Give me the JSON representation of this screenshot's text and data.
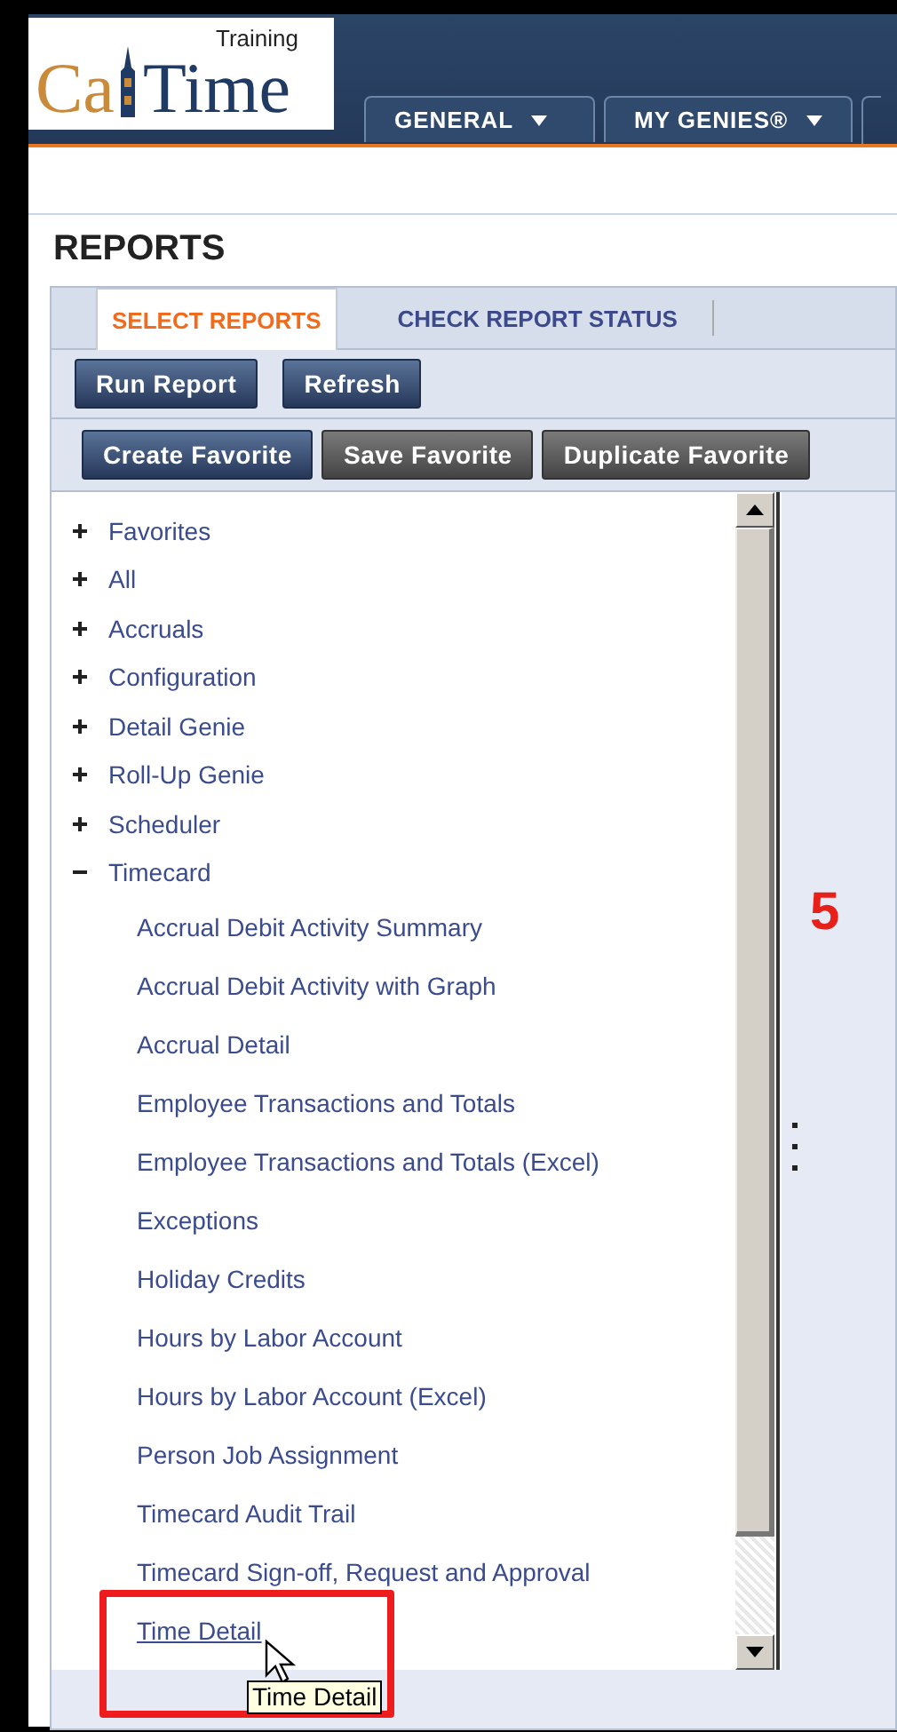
{
  "logo": {
    "tag": "Training",
    "part1": "Ca",
    "part2": "Time"
  },
  "nav_tabs": [
    {
      "label": "GENERAL"
    },
    {
      "label": "MY GENIES®"
    }
  ],
  "page_title": "REPORTS",
  "report_tabs": [
    {
      "label": "SELECT REPORTS",
      "selected": true
    },
    {
      "label": "CHECK REPORT STATUS",
      "selected": false
    }
  ],
  "toolbar": [
    "Run Report",
    "Refresh"
  ],
  "favorite_buttons": [
    {
      "label": "Create Favorite",
      "kind": "primary"
    },
    {
      "label": "Save Favorite",
      "kind": "secondary"
    },
    {
      "label": "Duplicate Favorite",
      "kind": "secondary"
    }
  ],
  "tree": [
    {
      "label": "Favorites",
      "expanded": false
    },
    {
      "label": "All",
      "expanded": false
    },
    {
      "label": "Accruals",
      "expanded": false
    },
    {
      "label": "Configuration",
      "expanded": false
    },
    {
      "label": "Detail Genie",
      "expanded": false
    },
    {
      "label": "Roll-Up Genie",
      "expanded": false
    },
    {
      "label": "Scheduler",
      "expanded": false
    },
    {
      "label": "Timecard",
      "expanded": true,
      "children": [
        {
          "label": "Accrual Debit Activity Summary",
          "hovered": false
        },
        {
          "label": "Accrual Debit Activity with Graph",
          "hovered": false
        },
        {
          "label": "Accrual Detail",
          "hovered": false
        },
        {
          "label": "Employee Transactions and Totals",
          "hovered": false
        },
        {
          "label": "Employee Transactions and Totals (Excel)",
          "hovered": false
        },
        {
          "label": "Exceptions",
          "hovered": false
        },
        {
          "label": "Holiday Credits",
          "hovered": false
        },
        {
          "label": "Hours by Labor Account",
          "hovered": false
        },
        {
          "label": "Hours by Labor Account (Excel)",
          "hovered": false
        },
        {
          "label": "Person Job Assignment",
          "hovered": false
        },
        {
          "label": "Timecard Audit Trail",
          "hovered": false
        },
        {
          "label": "Timecard Sign-off, Request and Approval",
          "hovered": false
        },
        {
          "label": "Time Detail",
          "hovered": true
        }
      ]
    }
  ],
  "tooltip": "Time Detail",
  "step_number": "5"
}
